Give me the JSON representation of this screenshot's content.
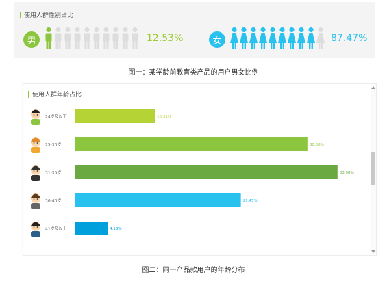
{
  "gender": {
    "title": "使用人群性别占比",
    "male": {
      "icon_label": "男",
      "percent_text": "12.53%",
      "value": 12.53,
      "color": "#8cc63f"
    },
    "female": {
      "icon_label": "女",
      "percent_text": "87.47%",
      "value": 87.47,
      "color": "#29c1ee"
    },
    "inactive_color": "#dddddd"
  },
  "caption1": "图一：某学龄前教育类产品的用户男女比例",
  "age": {
    "title": "使用人群年龄占比"
  },
  "caption2": "图二：同一产品款用户的年龄分布",
  "chart_data": [
    {
      "type": "pictogram",
      "title": "使用人群性别占比",
      "categories": [
        "男",
        "女"
      ],
      "values": [
        12.53,
        87.47
      ],
      "value_labels": [
        "12.53%",
        "87.47%"
      ],
      "colors": [
        "#8cc63f",
        "#29c1ee"
      ]
    },
    {
      "type": "bar",
      "orientation": "horizontal",
      "title": "使用人群年龄占比",
      "categories": [
        "24岁及以下",
        "25-30岁",
        "31-35岁",
        "36-40岁",
        "41岁及以上"
      ],
      "values": [
        10.31,
        30.08,
        33.98,
        21.45,
        4.18
      ],
      "value_labels": [
        "10.31%",
        "30.08%",
        "33.98%",
        "21.45%",
        "4.18%"
      ],
      "colors": [
        "#b5d334",
        "#8cc63f",
        "#6aa842",
        "#29c1ee",
        "#00a0dc"
      ],
      "label_colors": [
        "#b5d334",
        "#8cc63f",
        "#6aa842",
        "#29c1ee",
        "#00a0dc"
      ],
      "xlim": [
        0,
        34
      ]
    }
  ]
}
